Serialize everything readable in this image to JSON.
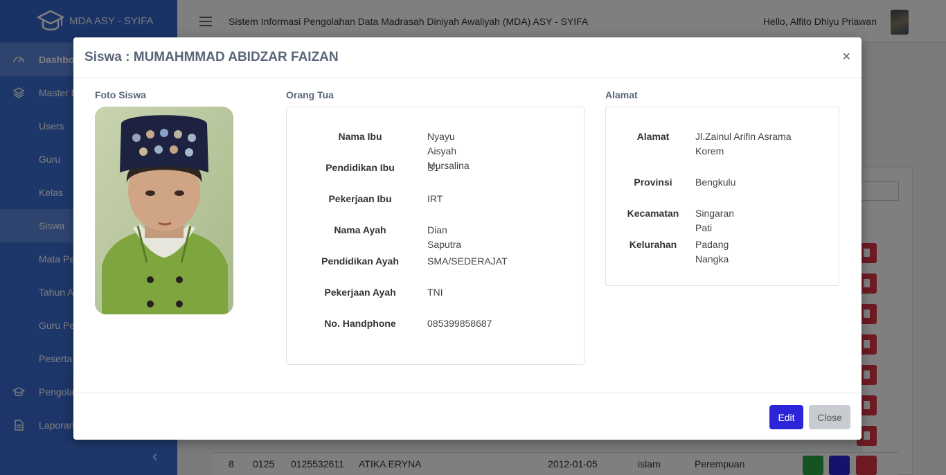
{
  "app": {
    "brand": "MDA ASY - SYIFA",
    "header_title": "Sistem Informasi Pengolahan Data Madrasah Diniyah Awaliyah (MDA) ASY - SYIFA",
    "greeting": "Hello, Alfito Dhiyu Priawan"
  },
  "sidebar": {
    "items": [
      {
        "label": "Dashbo",
        "icon": "dashboard-icon"
      },
      {
        "label": "Master D",
        "icon": "layers-icon"
      },
      {
        "label": "Users"
      },
      {
        "label": "Guru"
      },
      {
        "label": "Kelas"
      },
      {
        "label": "Siswa"
      },
      {
        "label": "Mata Pe"
      },
      {
        "label": "Tahun A"
      },
      {
        "label": "Guru Pe"
      },
      {
        "label": "Peserta"
      },
      {
        "label": "Pengola",
        "icon": "graduation-cap-icon"
      },
      {
        "label": "Laporan",
        "icon": "file-icon"
      }
    ]
  },
  "bg_table": {
    "row": {
      "no": "8",
      "nis": "0125",
      "nisn": "0125532611",
      "name": "ATIKA ERYNA",
      "dob": "2012-01-05",
      "religion": "islam",
      "gender": "Perempuan"
    }
  },
  "modal": {
    "title": "Siswa : MUMAHMMAD ABIDZAR FAIZAN",
    "close_glyph": "×",
    "photo_label": "Foto Siswa",
    "parents_label": "Orang Tua",
    "address_label": "Alamat",
    "parents": [
      {
        "key": "Nama Ibu",
        "value": "Nyayu Aisyah Mursalina"
      },
      {
        "key": "Pendidikan Ibu",
        "value": "S1"
      },
      {
        "key": "Pekerjaan Ibu",
        "value": "IRT"
      },
      {
        "key": "Nama Ayah",
        "value": "Dian Saputra"
      },
      {
        "key": "Pendidikan Ayah",
        "value": "SMA/SEDERAJAT"
      },
      {
        "key": "Pekerjaan Ayah",
        "value": "TNI"
      },
      {
        "key": "No. Handphone",
        "value": "085399858687"
      }
    ],
    "address": [
      {
        "key": "Alamat",
        "value": "Jl.Zainul Arifin Asrama Korem"
      },
      {
        "key": "Provinsi",
        "value": "Bengkulu"
      },
      {
        "key": "Kecamatan",
        "value": "Singaran Pati"
      },
      {
        "key": "Kelurahan",
        "value": "Padang Nangka"
      }
    ],
    "edit_label": "Edit",
    "close_label": "Close"
  },
  "colors": {
    "sidebar": "#3d6fd6",
    "edit_button": "#2b24d8",
    "delete_button": "#dc3545",
    "view_button": "#28a745"
  }
}
